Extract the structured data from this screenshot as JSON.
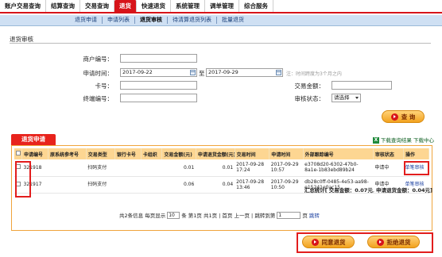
{
  "topnav": [
    "账户交易查询",
    "结算查询",
    "交易查询",
    "退货",
    "快速退货",
    "系统管理",
    "调单管理",
    "综合服务"
  ],
  "topnav_active": 3,
  "subnav": [
    "退货申请",
    "申请列表",
    "退货审核",
    "待清算退货列表",
    "批量退货"
  ],
  "subnav_active": 2,
  "section_title": "退货审核",
  "form": {
    "merchant_label": "商户编号：",
    "apply_time_label": "申请时间：",
    "date_from": "2017-09-22",
    "to_label": "至",
    "date_to": "2017-09-29",
    "range_hint": "注：时间跨度为3个月之内",
    "card_label": "卡号：",
    "amount_label": "交易金额：",
    "terminal_label": "终端编号：",
    "status_label": "审核状态：",
    "status_value": "请选择"
  },
  "query_button": "查 询",
  "panel_tab": "退货申请",
  "download_link": "下载查询结果 下载中心",
  "table": {
    "headers": [
      "申请编号",
      "原系统参考号",
      "交易类型",
      "银行卡号",
      "卡组织",
      "交易金额(元)",
      "申请退货金额(元)",
      "交易时间",
      "申请时间",
      "外部跟踪编号",
      "审核状态",
      "操作"
    ],
    "rows": [
      {
        "id": "321918",
        "ref": "",
        "type": "扫码支付",
        "card": "",
        "org": "",
        "amount": "0.01",
        "refund": "0.01",
        "trade_time": "2017-09-28 17:24",
        "apply_time": "2017-09-29 10:57",
        "trace": "e3708d20-6302-47b0-8a1e-1b83ebd89b24",
        "status": "申请中",
        "op": "单笔审核"
      },
      {
        "id": "321917",
        "ref": "",
        "type": "扫码支付",
        "card": "",
        "org": "",
        "amount": "0.06",
        "refund": "0.04",
        "trade_time": "2017-09-28 13:46",
        "apply_time": "2017-09-29 10:50",
        "trace": "db28c0ff-0485-4e53-aa98-e15241e0ac15",
        "status": "申请中",
        "op": "单笔审核"
      }
    ]
  },
  "summary": {
    "label": "汇总统计[",
    "trade_total": "交易金额：0.07元",
    "refund_total": "申请退货金额：0.04元",
    "close": "]"
  },
  "pager": {
    "text1": "共2条信息 每页显示",
    "per_page": "10",
    "text2": "条 第1页 共1页 | 首页 上一页 | 跳转到第",
    "goto_page": "1",
    "text3": "页",
    "goto": "跳转"
  },
  "buttons": {
    "approve": "同意退货",
    "reject": "拒绝退货"
  }
}
